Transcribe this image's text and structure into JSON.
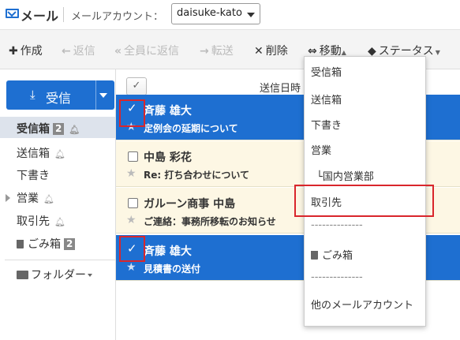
{
  "header": {
    "app_title": "メール",
    "account_label": "メールアカウント：",
    "account_value": "daisuke-kato"
  },
  "toolbar": {
    "compose": "作成",
    "reply": "返信",
    "reply_all": "全員に返信",
    "forward": "転送",
    "delete": "削除",
    "move": "移動",
    "status": "ステータス"
  },
  "sidebar": {
    "receive_button": "受信",
    "folders": [
      {
        "label": "受信箱",
        "badge": "2"
      },
      {
        "label": "送信箱"
      },
      {
        "label": "下書き"
      },
      {
        "label": "営業"
      },
      {
        "label": "取引先"
      },
      {
        "label": "ごみ箱",
        "badge": "2"
      }
    ],
    "folder_root": "フォルダー"
  },
  "list": {
    "sort_label": "送信日時",
    "messages": [
      {
        "sender": "斉藤 雄大",
        "subject": "定例会の延期について",
        "selected": true
      },
      {
        "sender": "中島 彩花",
        "subject": "Re: 打ち合わせについて",
        "selected": false
      },
      {
        "sender": "ガルーン商事 中島",
        "subject": "ご連絡：事務所移転のお知らせ",
        "selected": false
      },
      {
        "sender": "斉藤 雄大",
        "subject": "見積書の送付",
        "selected": true
      }
    ]
  },
  "move_menu": {
    "items": [
      "受信箱",
      "送信箱",
      "下書き",
      "営業",
      "└国内営業部",
      "取引先",
      "--------------",
      "ごみ箱",
      "--------------",
      "他のメールアカウント"
    ]
  },
  "colors": {
    "accent": "#1e6fd1",
    "highlight_box": "#d9262c",
    "row_unselected": "#fdf7e4"
  }
}
